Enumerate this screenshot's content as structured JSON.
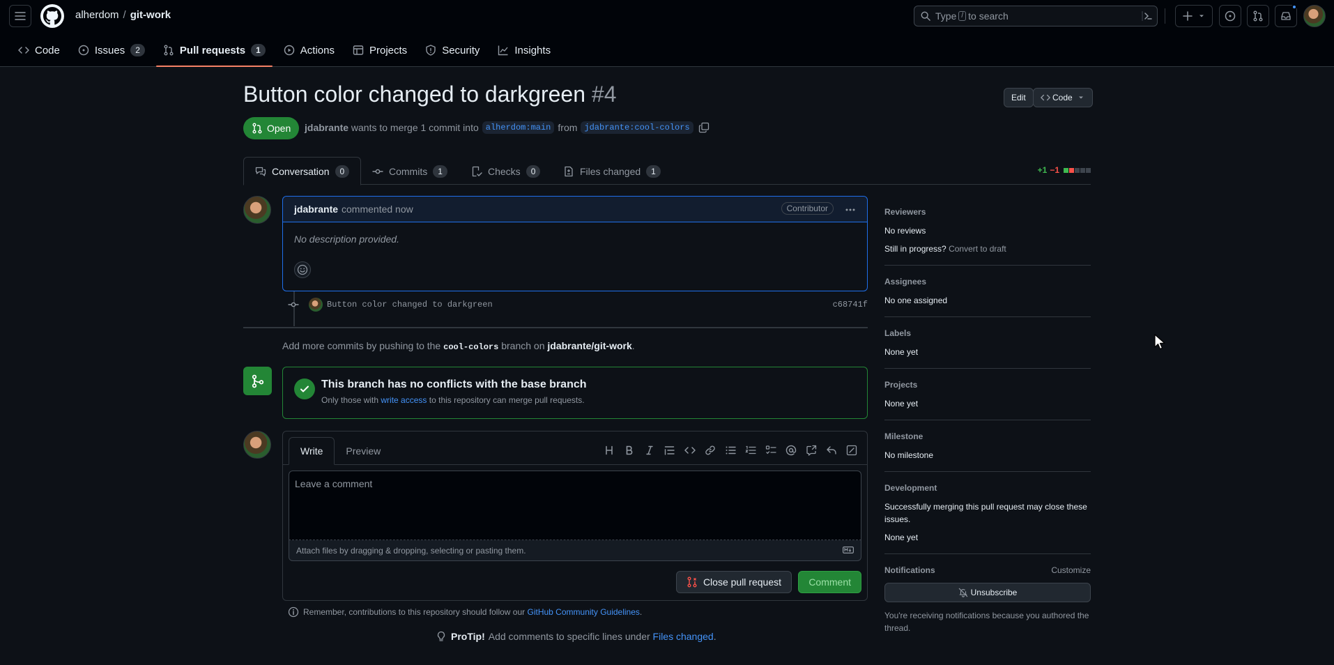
{
  "header": {
    "owner": "alherdom",
    "separator": "/",
    "repo": "git-work",
    "search_placeholder_prefix": "Type",
    "search_key": "/",
    "search_placeholder_suffix": "to search"
  },
  "repo_nav": [
    {
      "label": "Code",
      "icon": "code-icon",
      "count": null
    },
    {
      "label": "Issues",
      "icon": "issue-icon",
      "count": "2"
    },
    {
      "label": "Pull requests",
      "icon": "pull-request-icon",
      "count": "1",
      "active": true
    },
    {
      "label": "Actions",
      "icon": "play-icon",
      "count": null
    },
    {
      "label": "Projects",
      "icon": "table-icon",
      "count": null
    },
    {
      "label": "Security",
      "icon": "shield-icon",
      "count": null
    },
    {
      "label": "Insights",
      "icon": "graph-icon",
      "count": null
    }
  ],
  "pr": {
    "title": "Button color changed to darkgreen",
    "number": "#4",
    "state": "Open",
    "author": "jdabrante",
    "merge_text": "wants to merge 1 commit into",
    "base_branch": "alherdom:main",
    "from_text": "from",
    "head_branch": "jdabrante:cool-colors",
    "edit_label": "Edit",
    "code_label": "Code"
  },
  "tabs": [
    {
      "label": "Conversation",
      "count": "0"
    },
    {
      "label": "Commits",
      "count": "1"
    },
    {
      "label": "Checks",
      "count": "0"
    },
    {
      "label": "Files changed",
      "count": "1"
    }
  ],
  "diffstat": {
    "additions": "+1",
    "deletions": "−1"
  },
  "comment": {
    "author": "jdabrante",
    "time": "commented now",
    "role": "Contributor",
    "body": "No description provided."
  },
  "commit": {
    "message": "Button color changed to darkgreen",
    "sha": "c68741f"
  },
  "push_note": {
    "prefix": "Add more commits by pushing to the",
    "branch": "cool-colors",
    "middle": "branch on",
    "repo": "jdabrante/git-work",
    "suffix": "."
  },
  "merge": {
    "title": "This branch has no conflicts with the base branch",
    "sub_prefix": "Only those with",
    "sub_link": "write access",
    "sub_suffix": "to this repository can merge pull requests."
  },
  "editor": {
    "write_tab": "Write",
    "preview_tab": "Preview",
    "placeholder": "Leave a comment",
    "attach_text": "Attach files by dragging & dropping, selecting or pasting them.",
    "close_label": "Close pull request",
    "comment_label": "Comment"
  },
  "reminder": {
    "prefix": "Remember, contributions to this repository should follow our",
    "link": "GitHub Community Guidelines",
    "suffix": "."
  },
  "protip": {
    "bold": "ProTip!",
    "prefix": "Add comments to specific lines under",
    "link": "Files changed",
    "suffix": "."
  },
  "sidebar": {
    "reviewers_title": "Reviewers",
    "reviewers_value": "No reviews",
    "in_progress": "Still in progress?",
    "convert_draft": "Convert to draft",
    "assignees_title": "Assignees",
    "assignees_value": "No one assigned",
    "labels_title": "Labels",
    "labels_value": "None yet",
    "projects_title": "Projects",
    "projects_value": "None yet",
    "milestone_title": "Milestone",
    "milestone_value": "No milestone",
    "development_title": "Development",
    "development_text": "Successfully merging this pull request may close these issues.",
    "development_value": "None yet",
    "notifications_title": "Notifications",
    "customize": "Customize",
    "unsubscribe": "Unsubscribe",
    "notif_note": "You're receiving notifications because you authored the thread."
  },
  "colors": {
    "accent": "#4493f8",
    "success": "#238636",
    "danger": "#f85149",
    "background": "#0d1117"
  }
}
